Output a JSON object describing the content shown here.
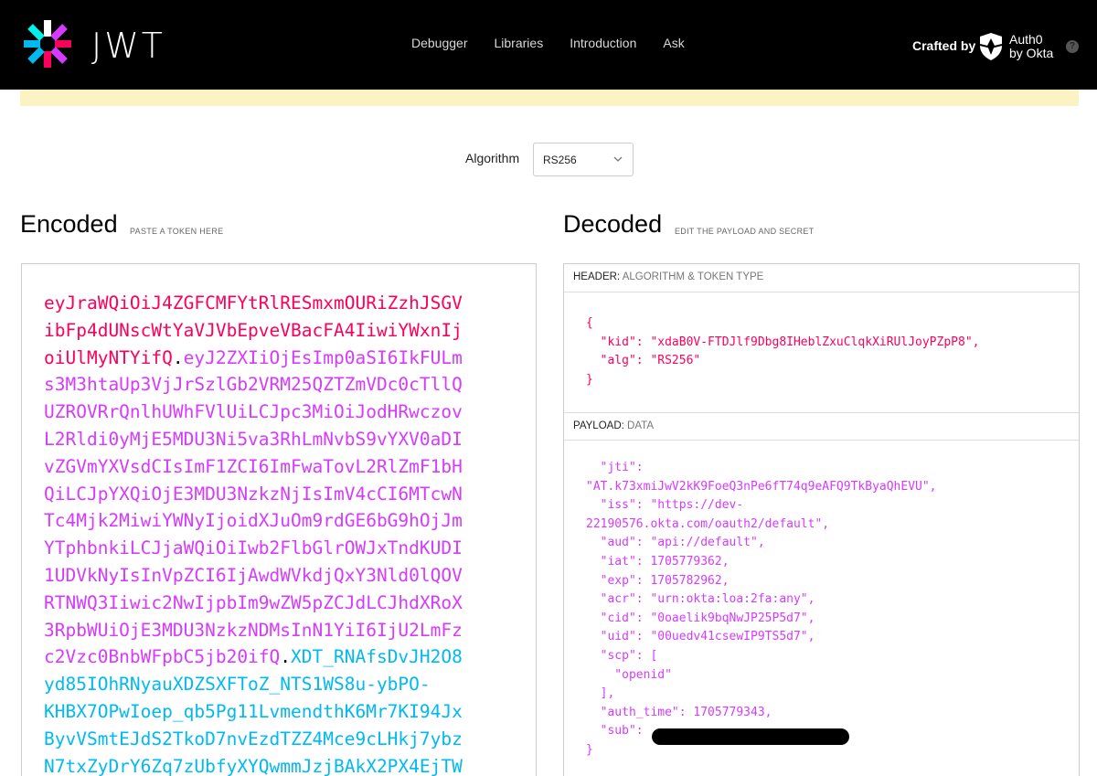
{
  "header": {
    "wordmark": "JWT",
    "nav": [
      "Debugger",
      "Libraries",
      "Introduction",
      "Ask"
    ],
    "crafted_by": "Crafted by",
    "brand_line1": "Auth0",
    "brand_line2": "by Okta",
    "help": "?"
  },
  "algorithm": {
    "label": "Algorithm",
    "value": "RS256"
  },
  "encoded": {
    "title": "Encoded",
    "subtitle": "PASTE A TOKEN HERE",
    "lines": [
      {
        "parts": [
          {
            "t": "eyJraWQiOiJ4ZGFCMFYtRlRESmxmOURiZzhJSGV",
            "c": "head"
          }
        ]
      },
      {
        "parts": [
          {
            "t": "ibFp4dUNscWtYaVJVbEpveVBacFA4IiwiYWxnIj",
            "c": "head"
          }
        ]
      },
      {
        "parts": [
          {
            "t": "oiUlMyNTYifQ",
            "c": "head"
          },
          {
            "t": ".",
            "c": "dot"
          },
          {
            "t": "eyJ2ZXIiOjEsImp0aSI6IkFULm",
            "c": "pay"
          }
        ]
      },
      {
        "parts": [
          {
            "t": "s3M3htaUp3VjJrSzlGb2VRM25QZTZmVDc0cTllQ",
            "c": "pay"
          }
        ]
      },
      {
        "parts": [
          {
            "t": "UZROVRrQnlhUWhFVlUiLCJpc3MiOiJodHRwczov",
            "c": "pay"
          }
        ]
      },
      {
        "parts": [
          {
            "t": "L2Rldi0yMjE5MDU3Ni5va3RhLmNvbS9vYXV0aDI",
            "c": "pay"
          }
        ]
      },
      {
        "parts": [
          {
            "t": "vZGVmYXVsdCIsImF1ZCI6ImFwaTovL2RlZmF1bH",
            "c": "pay"
          }
        ]
      },
      {
        "parts": [
          {
            "t": "QiLCJpYXQiOjE3MDU3NzkzNjIsImV4cCI6MTcwN",
            "c": "pay"
          }
        ]
      },
      {
        "parts": [
          {
            "t": "Tc4Mjk2MiwiYWNyIjoidXJuOm9rdGE6bG9hOjJm",
            "c": "pay"
          }
        ]
      },
      {
        "parts": [
          {
            "t": "YTphbnkiLCJjaWQiOiIwb2FlbGlrOWJxTndKUDI",
            "c": "pay"
          }
        ]
      },
      {
        "parts": [
          {
            "t": "1UDVkNyIsInVpZCI6IjAwdWVkdjQxY3Nld0lQOV",
            "c": "pay"
          }
        ]
      },
      {
        "parts": [
          {
            "t": "RTNWQ3Iiwic2NwIjpbIm9wZW5pZCJdLCJhdXRoX",
            "c": "pay"
          }
        ]
      },
      {
        "parts": [
          {
            "t": "3RpbWUiOjE3MDU3NzkzNDMsInN1YiI6IjU2LmFz",
            "c": "pay"
          }
        ]
      },
      {
        "parts": [
          {
            "t": "c2Vzc0BnbWFpbC5jb20ifQ",
            "c": "pay"
          },
          {
            "t": ".",
            "c": "dot"
          },
          {
            "t": "XDT_RNAfsDvJH2O8",
            "c": "sig"
          }
        ]
      },
      {
        "parts": [
          {
            "t": "yd85IOhRNyauXDZSXFToZ_NTS1WS8u-ybPO-",
            "c": "sig"
          }
        ]
      },
      {
        "parts": [
          {
            "t": "KHBX7OPwIoep_qb5Pg11LvmendthK6Mr7KI94Jx",
            "c": "sig"
          }
        ]
      },
      {
        "parts": [
          {
            "t": "ByvVSmtEJdS2TkoD7nvEzdTZZ4Mce9cLHkj7ybz",
            "c": "sig"
          }
        ]
      },
      {
        "parts": [
          {
            "t": "N7txZyDrY6Zq7zUbfyXYQwmmJzjBAkX2PX4EjTW",
            "c": "sig"
          }
        ]
      }
    ]
  },
  "decoded": {
    "title": "Decoded",
    "subtitle": "EDIT THE PAYLOAD AND SECRET",
    "header_label": "HEADER:",
    "header_sub": "ALGORITHM & TOKEN TYPE",
    "header_json": "{\n  \"kid\": \"xdaB0V-FTDJlf9Dbg8IHeblZxuClqkXiRUlJoyPZpP8\",\n  \"alg\": \"RS256\"\n}",
    "payload_label": "PAYLOAD:",
    "payload_sub": "DATA",
    "payload_json": "  \"jti\":\n\"AT.k73xmiJwV2kK9FoeQ3nPe6fT74q9eAFQ9TkByaQhEVU\",\n  \"iss\": \"https://dev-\n22190576.okta.com/oauth2/default\",\n  \"aud\": \"api://default\",\n  \"iat\": 1705779362,\n  \"exp\": 1705782962,\n  \"acr\": \"urn:okta:loa:2fa:any\",\n  \"cid\": \"0oaelik9bqNwJP25P5d7\",\n  \"uid\": \"00uedv41csewIP9TS5d7\",\n  \"scp\": [\n    \"openid\"\n  ],\n  \"auth_time\": 1705779343,\n  \"sub\":\n}"
  }
}
